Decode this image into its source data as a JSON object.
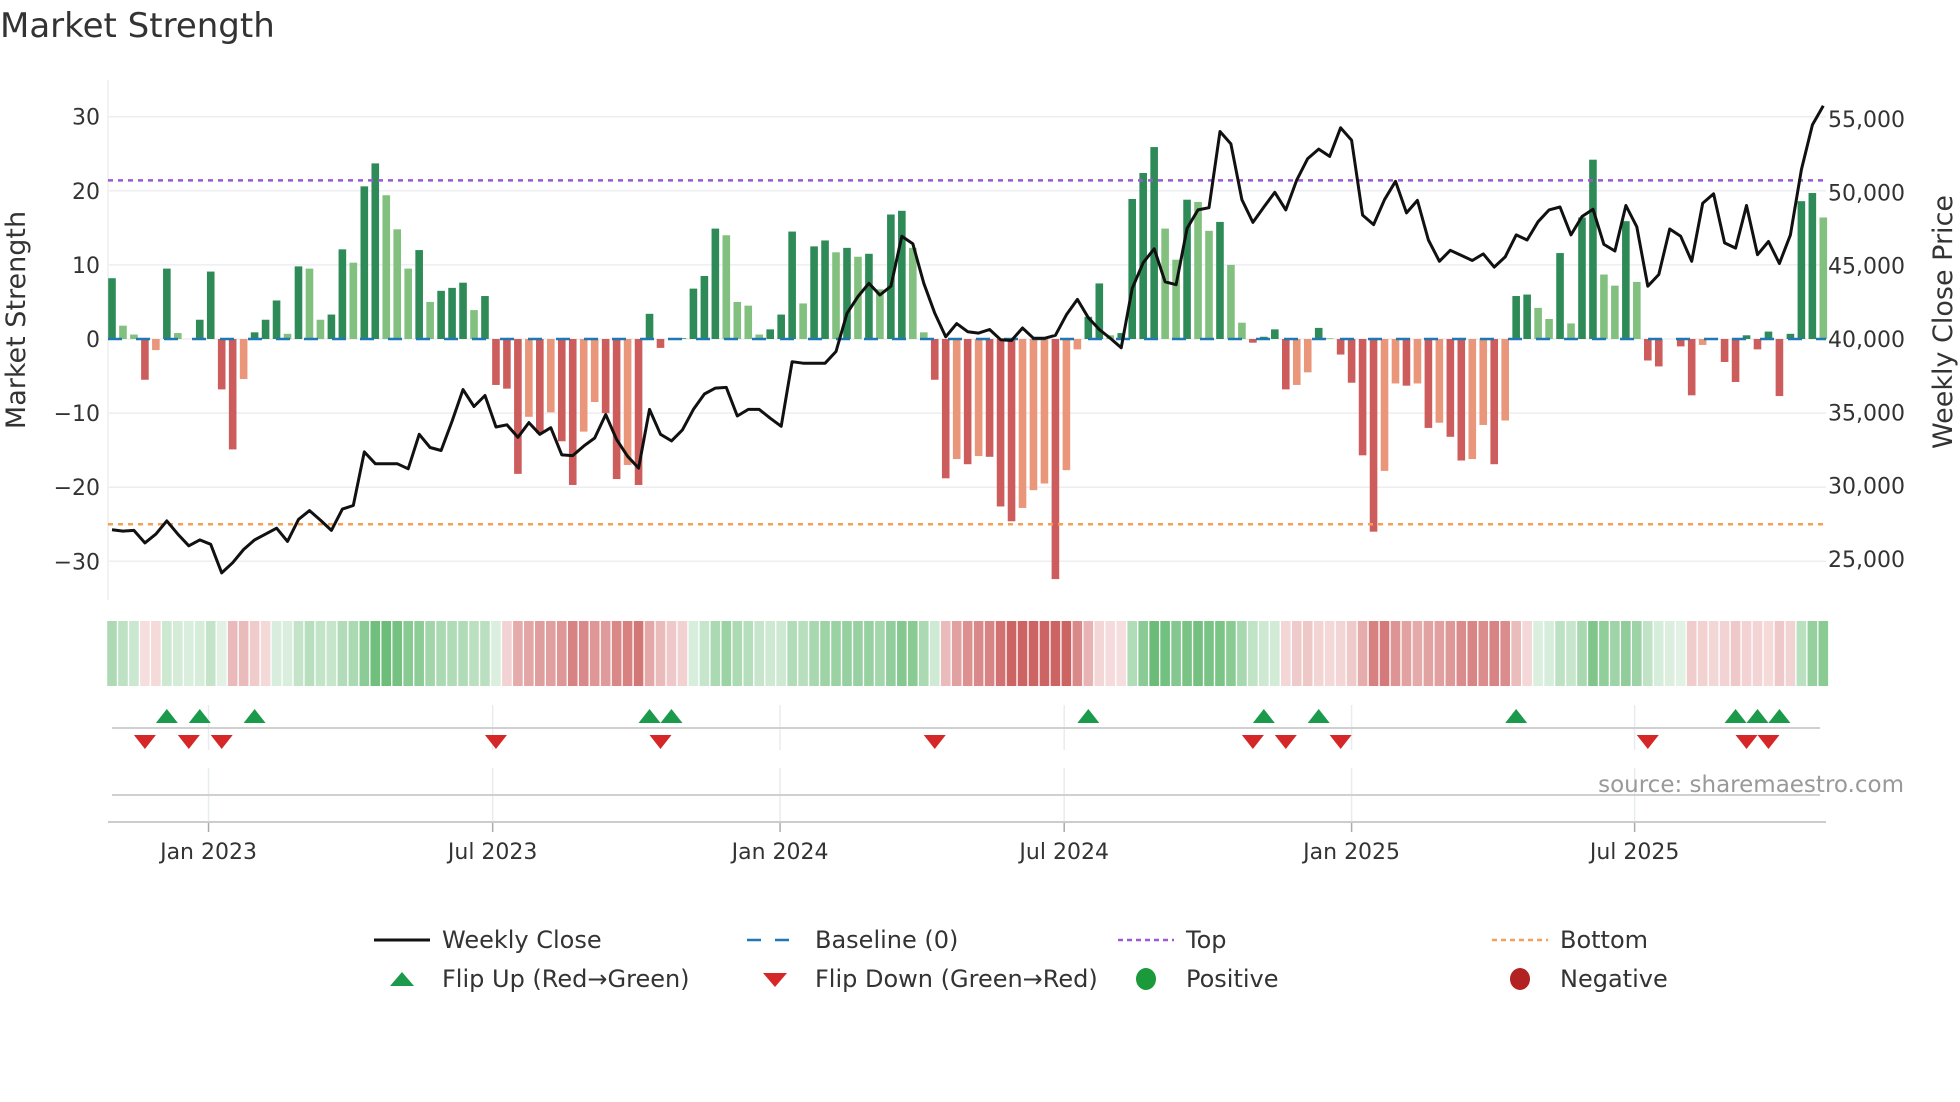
{
  "title": "Market Strength",
  "source": "source: sharemaestro.com",
  "colors": {
    "pos_strong": "#2e8b57",
    "pos_weak": "#81c07f",
    "neg_strong": "#cd5c5c",
    "neg_weak": "#e9967a",
    "line": "#111111",
    "baseline": "#1f77b4",
    "top": "#9b59d6",
    "bottom": "#f2a05a",
    "flip_up": "#1a9a4a",
    "flip_down": "#d62728",
    "positive": "#1a9a3a",
    "negative": "#b22222"
  },
  "legend": [
    {
      "key": "line",
      "label": "Weekly Close"
    },
    {
      "key": "baseline",
      "label": "Baseline (0)"
    },
    {
      "key": "top",
      "label": "Top"
    },
    {
      "key": "bottom",
      "label": "Bottom"
    },
    {
      "key": "flip_up",
      "label": "Flip Up (Red→Green)"
    },
    {
      "key": "flip_down",
      "label": "Flip Down (Green→Red)"
    },
    {
      "key": "positive",
      "label": "Positive"
    },
    {
      "key": "negative",
      "label": "Negative"
    }
  ],
  "chart_data": {
    "type": "bar+line",
    "title": "Market Strength",
    "ylabel": "Market Strength",
    "y2label": "Weekly Close Price",
    "ylim": [
      -35,
      34.7
    ],
    "y2lim": [
      22200,
      57550
    ],
    "yticks": [
      {
        "v": -30,
        "label": "−30"
      },
      {
        "v": -20,
        "label": "−20"
      },
      {
        "v": -10,
        "label": "−10"
      },
      {
        "v": 0,
        "label": "0"
      },
      {
        "v": 10,
        "label": "10"
      },
      {
        "v": 20,
        "label": "20"
      },
      {
        "v": 30,
        "label": "30"
      }
    ],
    "y2ticks": [
      {
        "v": 25000,
        "label": "25,000"
      },
      {
        "v": 30000,
        "label": "30,000"
      },
      {
        "v": 35000,
        "label": "35,000"
      },
      {
        "v": 40000,
        "label": "40,000"
      },
      {
        "v": 45000,
        "label": "45,000"
      },
      {
        "v": 50000,
        "label": "50,000"
      },
      {
        "v": 55000,
        "label": "55,000"
      }
    ],
    "xticks": [
      {
        "week": 8.8,
        "label": "Jan 2023"
      },
      {
        "week": 34.7,
        "label": "Jul 2023"
      },
      {
        "week": 60.9,
        "label": "Jan 2024"
      },
      {
        "week": 86.8,
        "label": "Jul 2024"
      },
      {
        "week": 113,
        "label": "Jan 2025"
      },
      {
        "week": 138.8,
        "label": "Jul 2025"
      }
    ],
    "top_level": 21.4,
    "bottom_level": -25.0,
    "baseline": 0,
    "strength": [
      8.2,
      1.8,
      0.6,
      -5.5,
      -1.5,
      9.5,
      0.8,
      0,
      2.6,
      9.1,
      -6.8,
      -14.9,
      -5.4,
      0.9,
      2.6,
      5.2,
      0.7,
      9.8,
      9.5,
      2.6,
      3.3,
      12.1,
      10.3,
      20.6,
      23.7,
      19.4,
      14.8,
      9.5,
      12.0,
      5.0,
      6.5,
      6.9,
      7.6,
      3.9,
      5.8,
      -6.2,
      -6.7,
      -18.2,
      -10.5,
      -12.7,
      -9.9,
      -13.8,
      -19.7,
      -12.5,
      -8.5,
      -10.0,
      -18.9,
      -17.0,
      -19.7,
      3.4,
      -1.2,
      0,
      0.1,
      6.8,
      8.5,
      14.9,
      14.0,
      5.0,
      4.5,
      0.6,
      1.3,
      3.3,
      14.5,
      4.8,
      12.5,
      13.3,
      11.7,
      12.3,
      11.1,
      11.5,
      6.7,
      16.8,
      17.3,
      12.3,
      0.9,
      -5.5,
      -18.8,
      -16.2,
      -16.9,
      -15.8,
      -15.9,
      -22.6,
      -24.6,
      -22.8,
      -20.4,
      -19.5,
      -32.4,
      -17.7,
      -1.4,
      3.0,
      7.5,
      0.5,
      0.8,
      18.9,
      22.4,
      25.9,
      14.9,
      10.7,
      18.8,
      18.5,
      14.6,
      15.8,
      10.0,
      2.2,
      -0.5,
      0.3,
      1.3,
      -6.8,
      -6.2,
      -4.5,
      1.5,
      0.1,
      -2.1,
      -5.9,
      -15.7,
      -26.0,
      -17.8,
      -6.0,
      -6.3,
      -6.0,
      -12.0,
      -11.3,
      -13.2,
      -16.4,
      -16.2,
      -11.6,
      -16.9,
      -11.0,
      5.8,
      6.0,
      4.2,
      2.7,
      11.6,
      2.1,
      16.4,
      24.2,
      8.7,
      7.2,
      15.9,
      7.7,
      -2.9,
      -3.7,
      0,
      -1.0,
      -7.6,
      -0.8,
      0,
      -3.1,
      -5.8,
      0.5,
      -1.4,
      1.0,
      -7.7,
      0.7,
      18.6,
      19.7,
      16.4
    ],
    "weekly_close": [
      27000,
      26900,
      26950,
      26100,
      26700,
      27600,
      26700,
      25900,
      26300,
      26000,
      24050,
      24750,
      25650,
      26300,
      26700,
      27100,
      26200,
      27700,
      28300,
      27650,
      26950,
      28400,
      28650,
      32300,
      31500,
      31500,
      31500,
      31150,
      33500,
      32600,
      32400,
      34400,
      36550,
      35400,
      36150,
      34000,
      34150,
      33300,
      34300,
      33500,
      33950,
      32100,
      32050,
      32700,
      33250,
      34850,
      33150,
      32000,
      31200,
      35200,
      33500,
      33050,
      33800,
      35200,
      36250,
      36650,
      36700,
      34750,
      35200,
      35200,
      34600,
      34050,
      38450,
      38350,
      38350,
      38350,
      39150,
      41750,
      42900,
      43800,
      43000,
      43600,
      47000,
      46500,
      43800,
      41750,
      40150,
      41050,
      40500,
      40400,
      40650,
      39950,
      39900,
      40750,
      40050,
      40050,
      40250,
      41650,
      42700,
      41450,
      40650,
      40050,
      39400,
      43450,
      45200,
      46150,
      43900,
      43700,
      47550,
      48800,
      48950,
      54150,
      53300,
      49500,
      47950,
      49000,
      50000,
      48800,
      50850,
      52300,
      52950,
      52450,
      54400,
      53550,
      48450,
      47800,
      49500,
      50750,
      48600,
      49450,
      46750,
      45300,
      46050,
      45700,
      45350,
      45800,
      44900,
      45600,
      47100,
      46750,
      48000,
      48800,
      49000,
      47100,
      48350,
      48850,
      46450,
      46000,
      49100,
      47650,
      43600,
      44400,
      47500,
      47000,
      45300,
      49250,
      49900,
      46550,
      46200,
      49100,
      45750,
      46650,
      45150,
      47100,
      51550,
      54600,
      55900
    ],
    "flip_up_weeks": [
      5,
      8,
      13,
      49,
      51,
      89,
      105,
      110,
      128,
      148,
      150,
      152
    ],
    "flip_down_weeks": [
      3,
      7,
      10,
      35,
      50,
      75,
      104,
      107,
      112,
      140,
      149,
      151
    ]
  }
}
